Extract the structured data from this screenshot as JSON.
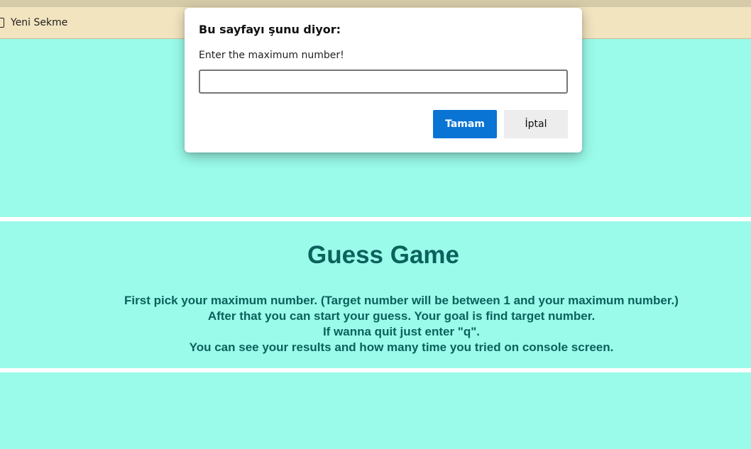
{
  "browser": {
    "bookmark": {
      "label": "Yeni Sekme",
      "icon": "page-icon"
    }
  },
  "page": {
    "background_color": "#9afbea",
    "title": "Guess Game",
    "instructions": [
      "First pick your maximum number. (Target number will be between 1 and your maximum number.)",
      "After that you can start your guess. Your goal is find target number.",
      "If wanna quit just enter \"q\".",
      "You can see your results and how many time you tried on console screen."
    ]
  },
  "dialog": {
    "title": "Bu sayfayı şunu diyor:",
    "message": "Enter the maximum number!",
    "input_value": "",
    "ok_label": "Tamam",
    "cancel_label": "İptal",
    "ok_color": "#0a74d4"
  }
}
